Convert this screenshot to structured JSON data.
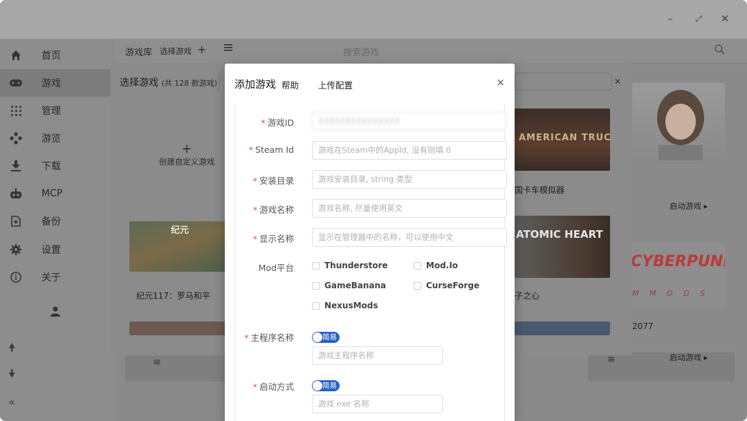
{
  "window": {
    "minimize": "–",
    "maximize": "⤢",
    "close": "✕"
  },
  "sidebar": {
    "items": [
      {
        "label": "首页",
        "icon": "home-icon"
      },
      {
        "label": "游戏",
        "icon": "gamepad-icon"
      },
      {
        "label": "管理",
        "icon": "grid-icon"
      },
      {
        "label": "游览",
        "icon": "browse-icon"
      },
      {
        "label": "下载",
        "icon": "download-icon"
      },
      {
        "label": "MCP",
        "icon": "robot-icon"
      },
      {
        "label": "备份",
        "icon": "backup-icon"
      },
      {
        "label": "设置",
        "icon": "gear-icon"
      },
      {
        "label": "关于",
        "icon": "info-icon"
      }
    ],
    "active_index": 1
  },
  "main_header": {
    "library": "游戏库",
    "select_game": "选择游戏",
    "plus": "+",
    "search_placeholder": "搜索游戏"
  },
  "select_modal": {
    "title": "选择游戏",
    "count": "(共 128 款游戏)",
    "create_plus": "+",
    "create_label": "创建自定义游戏",
    "games": [
      {
        "name": "纪元117：罗马和平",
        "banner": "纪元"
      },
      {
        "name": "国卡车模拟器",
        "banner": "AMERICAN TRUCK"
      },
      {
        "name": "子之心",
        "banner": "ATOMIC HEART"
      },
      {
        "name": "2077",
        "banner": "CYBERPUNK"
      }
    ],
    "launch_label": "启动游戏",
    "close": "✕"
  },
  "add_modal": {
    "title": "添加游戏",
    "tabs": [
      "帮助",
      "上传配置"
    ],
    "close": "×",
    "fields": {
      "game_id": {
        "label": "游戏ID",
        "value": "XXXXXXXXXXXXXXX"
      },
      "steam_id": {
        "label": "Steam Id",
        "placeholder": "游戏在Steam中的AppId, 没有则填 0"
      },
      "install_dir": {
        "label": "安装目录",
        "placeholder": "游戏安装目录, string 类型"
      },
      "game_name": {
        "label": "游戏名称",
        "placeholder": "游戏名称, 尽量使用英文"
      },
      "display_name": {
        "label": "显示名称",
        "placeholder": "显示在管理器中的名称，可以使用中文"
      },
      "mod_platform": {
        "label": "Mod平台",
        "options": [
          "Thunderstore",
          "Mod.Io",
          "GameBanana",
          "CurseForge",
          "NexusMods"
        ]
      },
      "main_program": {
        "label": "主程序名称",
        "toggle": "简易",
        "placeholder": "游戏主程序名称"
      },
      "launch_method": {
        "label": "启动方式",
        "toggle": "简易",
        "placeholder": "游戏 exe 名称"
      }
    }
  }
}
